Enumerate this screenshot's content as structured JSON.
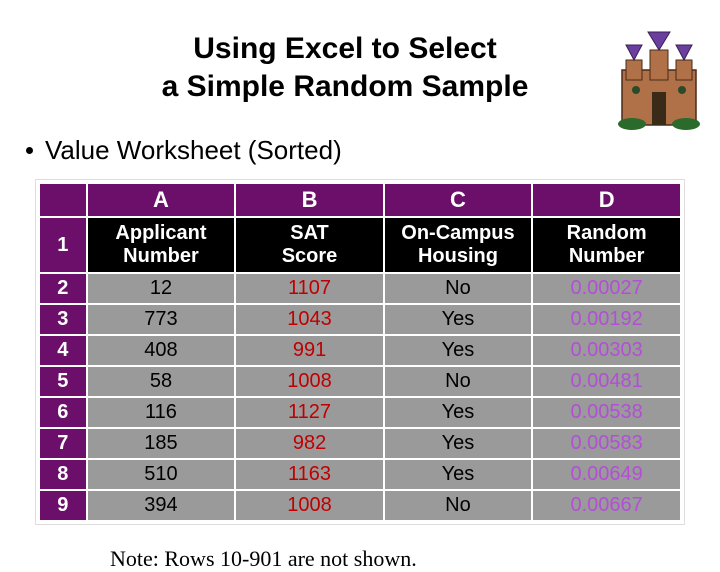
{
  "title_line1": "Using Excel to Select",
  "title_line2": "a Simple Random Sample",
  "subtitle": "Value Worksheet (Sorted)",
  "note": "Note:  Rows 10-901 are not shown.",
  "columns": {
    "A": "A",
    "B": "B",
    "C": "C",
    "D": "D"
  },
  "row_labels": [
    "1",
    "2",
    "3",
    "4",
    "5",
    "6",
    "7",
    "8",
    "9"
  ],
  "headers": {
    "A_l1": "Applicant",
    "A_l2": "Number",
    "B_l1": "SAT",
    "B_l2": "Score",
    "C_l1": "On-Campus",
    "C_l2": "Housing",
    "D_l1": "Random",
    "D_l2": "Number"
  },
  "rows": [
    {
      "A": "12",
      "B": "1107",
      "C": "No",
      "D": "0.00027"
    },
    {
      "A": "773",
      "B": "1043",
      "C": "Yes",
      "D": "0.00192"
    },
    {
      "A": "408",
      "B": "991",
      "C": "Yes",
      "D": "0.00303"
    },
    {
      "A": "58",
      "B": "1008",
      "C": "No",
      "D": "0.00481"
    },
    {
      "A": "116",
      "B": "1127",
      "C": "Yes",
      "D": "0.00538"
    },
    {
      "A": "185",
      "B": "982",
      "C": "Yes",
      "D": "0.00583"
    },
    {
      "A": "510",
      "B": "1163",
      "C": "Yes",
      "D": "0.00649"
    },
    {
      "A": "394",
      "B": "1008",
      "C": "No",
      "D": "0.00667"
    }
  ]
}
